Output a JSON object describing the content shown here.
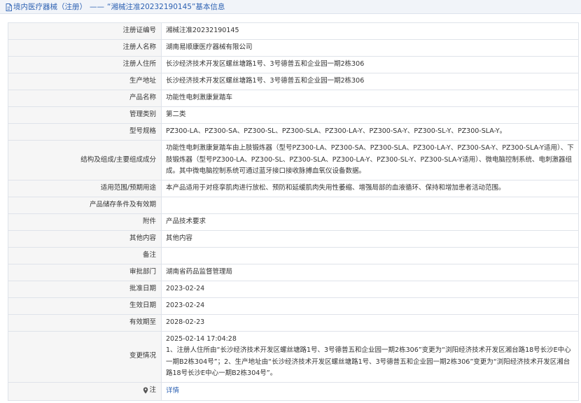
{
  "breadcrumb": {
    "prefix": "境内医疗器械（注册）",
    "separator": "——",
    "record_title": "“湘械注准20232190145”基本信息"
  },
  "icons": {
    "doc": "document-icon",
    "pin": "map-pin-icon"
  },
  "colors": {
    "link": "#2e62b3",
    "label_bg": "#f6f6f6",
    "border": "#dfe3ea"
  },
  "rows": [
    {
      "label": "注册证编号",
      "value": "湘械注准20232190145"
    },
    {
      "label": "注册人名称",
      "value": "湖南易顺康医疗器械有限公司"
    },
    {
      "label": "注册人住所",
      "value": "长沙经济技术开发区螺丝塘路1号、3号德普五和企业园一期2栋306"
    },
    {
      "label": "生产地址",
      "value": "长沙经济技术开发区螺丝塘路1号、3号德普五和企业园一期2栋306"
    },
    {
      "label": "产品名称",
      "value": "功能性电刺激康复踏车"
    },
    {
      "label": "管理类别",
      "value": "第二类"
    },
    {
      "label": "型号规格",
      "value": "PZ300-LA、PZ300-SA、PZ300-SL、PZ300-SLA、PZ300-LA-Y、PZ300-SA-Y、PZ300-SL-Y、PZ300-SLA-Y。"
    },
    {
      "label": "结构及组成/主要组成成分",
      "value": "功能性电刺激康复踏车由上肢锻炼器（型号PZ300-LA、PZ300-SA、PZ300-SLA、PZ300-LA-Y、PZ300-SA-Y、PZ300-SLA-Y适用）、下肢锻炼器（型号PZ300-LA、PZ300-SL、PZ300-SLA、PZ300-LA-Y、PZ300-SL-Y、PZ300-SLA-Y适用）、微电脑控制系统、电刺激器组成。其中微电脑控制系统可通过蓝牙接口接收脉搏血氧仪设备数据。"
    },
    {
      "label": "适用范围/预期用途",
      "value": "本产品适用于对痉挛肌肉进行放松、预防和延缓肌肉失用性萎缩、增强局部的血液循环、保持和增加患者活动范围。"
    },
    {
      "label": "产品储存条件及有效期",
      "value": ""
    },
    {
      "label": "附件",
      "value": "产品技术要求"
    },
    {
      "label": "其他内容",
      "value": "其他内容"
    },
    {
      "label": "备注",
      "value": ""
    },
    {
      "label": "审批部门",
      "value": "湖南省药品监督管理局"
    },
    {
      "label": "批准日期",
      "value": "2023-02-24"
    },
    {
      "label": "生效日期",
      "value": "2023-02-24"
    },
    {
      "label": "有效期至",
      "value": "2028-02-23"
    }
  ],
  "change": {
    "label": "变更情况",
    "time": "2025-02-14 17:04:28",
    "text": "1、注册人住所由“长沙经济技术开发区螺丝塘路1号、3号德普五和企业园一期2栋306”变更为“浏阳经济技术开发区湘台路18号长沙E中心一期B2栋304号”；2、生产地址由“长沙经济技术开发区螺丝塘路1号、3号德普五和企业园一期2栋306”变更为“浏阳经济技术开发区湘台路18号长沙E中心一期B2栋304号”。"
  },
  "note": {
    "label": "注",
    "link_text": "详情"
  }
}
